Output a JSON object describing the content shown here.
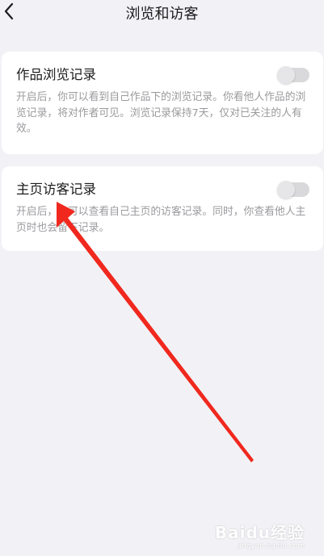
{
  "header": {
    "title": "浏览和访客",
    "back_icon": "chevron-left-icon"
  },
  "settings": [
    {
      "title": "作品浏览记录",
      "description": "开启后，你可以看到自己作品下的浏览记录。你看他人作品的浏览记录，将对作者可见。浏览记录保持7天，仅对已关注的人有效。",
      "enabled": false
    },
    {
      "title": "主页访客记录",
      "description": "开启后，你可以查看自己主页的访客记录。同时，你查看他人主页时也会留下记录。",
      "enabled": false
    }
  ],
  "annotation": {
    "arrow_color": "#f0281e"
  },
  "watermark": {
    "main": "Baidu经验",
    "sub": "jingyan.baidu.com"
  },
  "colors": {
    "background": "#f2f2f6",
    "card": "#ffffff",
    "toggle_off": "#d9d9dc"
  }
}
